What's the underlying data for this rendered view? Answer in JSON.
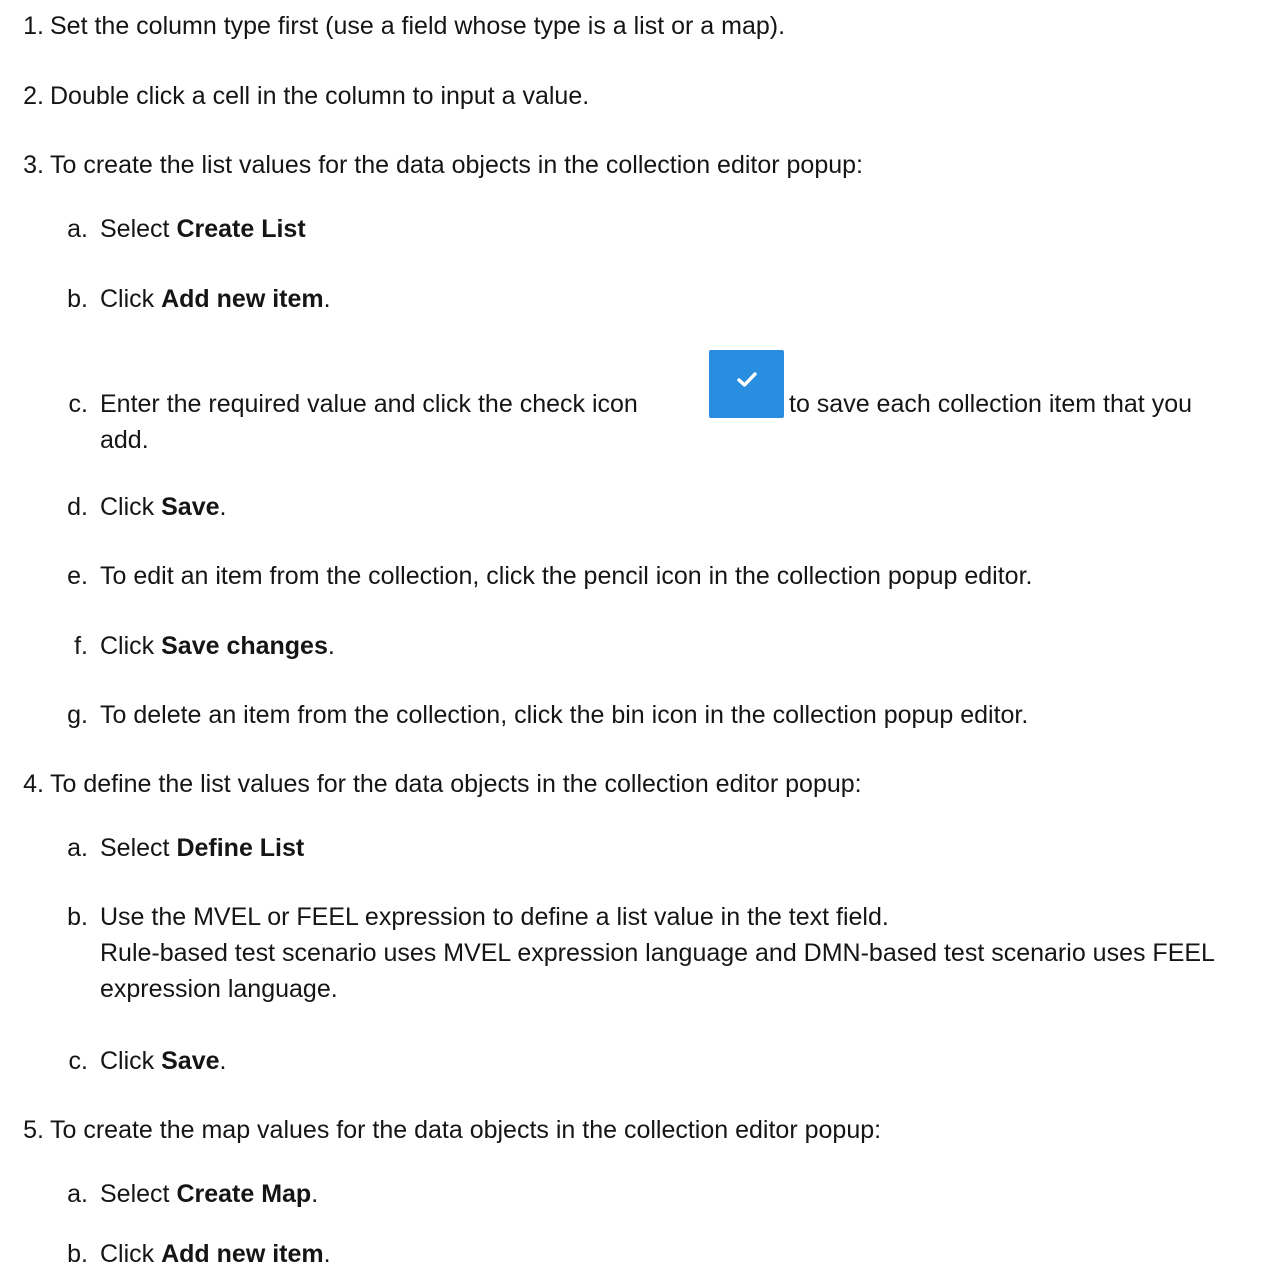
{
  "steps": [
    {
      "num": "1.",
      "text": "Set the column type first (use a field whose type is a list or a map)."
    },
    {
      "num": "2.",
      "text": "Double click a cell in the column to input a value."
    },
    {
      "num": "3.",
      "text": "To create the list values for the data objects in the collection editor popup:"
    },
    {
      "num": "4.",
      "text": "To define the list values for the data objects in the collection editor popup:"
    },
    {
      "num": "5.",
      "text": "To create the map values for the data objects in the collection editor popup:"
    }
  ],
  "step3": {
    "a": {
      "letter": "a.",
      "pre": "Select ",
      "bold": "Create List",
      "post": ""
    },
    "b": {
      "letter": "b.",
      "pre": "Click ",
      "bold": "Add new item",
      "post": "."
    },
    "c": {
      "letter": "c.",
      "pre": "Enter the required value and click the check icon",
      "post": "to save each collection item that you add."
    },
    "d": {
      "letter": "d.",
      "pre": "Click ",
      "bold": "Save",
      "post": "."
    },
    "e": {
      "letter": "e.",
      "text": "To edit an item from the collection, click the pencil icon in the collection popup editor."
    },
    "f": {
      "letter": "f.",
      "pre": "Click ",
      "bold": "Save changes",
      "post": "."
    },
    "g": {
      "letter": "g.",
      "text": "To delete an item from the collection, click the bin icon in the collection popup editor."
    }
  },
  "step4": {
    "a": {
      "letter": "a.",
      "pre": "Select ",
      "bold": "Define List",
      "post": ""
    },
    "b": {
      "letter": "b.",
      "line1": "Use the MVEL or FEEL expression to define a list value in the text field.",
      "line2": "Rule-based test scenario uses MVEL expression language and DMN-based test scenario uses FEEL expression language."
    },
    "c": {
      "letter": "c.",
      "pre": "Click ",
      "bold": "Save",
      "post": "."
    }
  },
  "step5": {
    "a": {
      "letter": "a.",
      "pre": "Select ",
      "bold": "Create Map",
      "post": "."
    },
    "b": {
      "letter": "b.",
      "pre": "Click ",
      "bold": "Add new item",
      "post": "."
    }
  },
  "icons": {
    "check_icon_color": "#2a8ee0"
  }
}
